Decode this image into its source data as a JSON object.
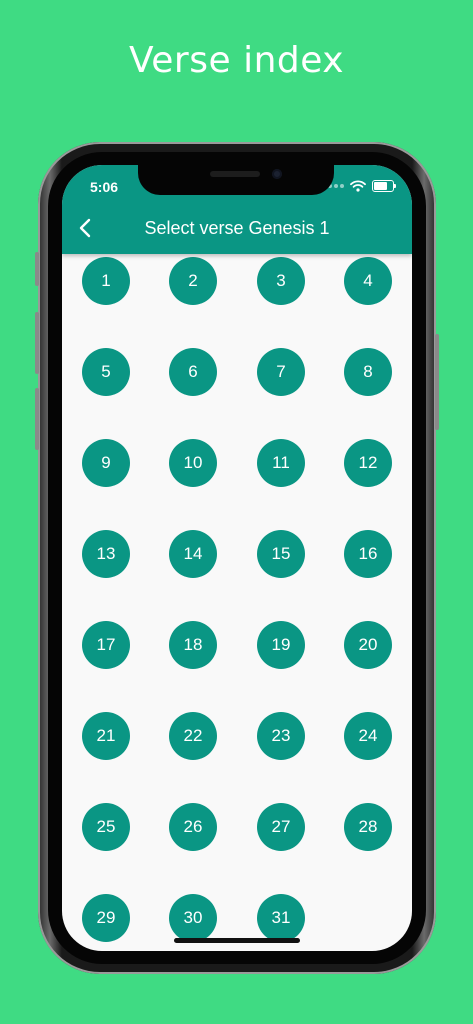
{
  "headline": "Verse index",
  "status_bar": {
    "time": "5:06",
    "icons": [
      "signal-dots-icon",
      "wifi-icon",
      "battery-icon"
    ]
  },
  "app_bar": {
    "back_icon": "chevron-left-icon",
    "title": "Select verse Genesis 1"
  },
  "verses": [
    "1",
    "2",
    "3",
    "4",
    "5",
    "6",
    "7",
    "8",
    "9",
    "10",
    "11",
    "12",
    "13",
    "14",
    "15",
    "16",
    "17",
    "18",
    "19",
    "20",
    "21",
    "22",
    "23",
    "24",
    "25",
    "26",
    "27",
    "28",
    "29",
    "30",
    "31"
  ],
  "colors": {
    "background": "#3fdb83",
    "primary": "#0a9684",
    "screen": "#f9f9f9",
    "text_on_primary": "#ffffff"
  }
}
